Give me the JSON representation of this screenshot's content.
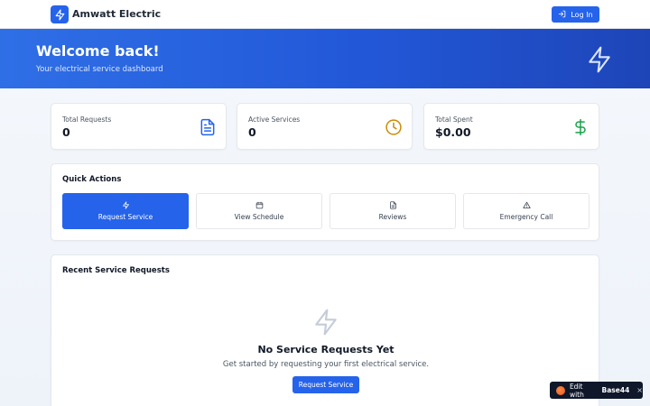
{
  "nav": {
    "brand": "Amwatt Electric",
    "login_label": "Log In"
  },
  "hero": {
    "title": "Welcome back!",
    "subtitle": "Your electrical service dashboard"
  },
  "stats": [
    {
      "label": "Total Requests",
      "value": "0",
      "icon": "document-icon",
      "color": "#2563eb"
    },
    {
      "label": "Active Services",
      "value": "0",
      "icon": "clock-icon",
      "color": "#ca8a04"
    },
    {
      "label": "Total Spent",
      "value": "$0.00",
      "icon": "dollar-icon",
      "color": "#16a34a"
    }
  ],
  "quick_actions": {
    "title": "Quick Actions",
    "items": [
      {
        "label": "Request Service",
        "icon": "bolt-icon"
      },
      {
        "label": "View Schedule",
        "icon": "calendar-icon"
      },
      {
        "label": "Reviews",
        "icon": "document-icon"
      },
      {
        "label": "Emergency Call",
        "icon": "warning-icon"
      }
    ]
  },
  "recent": {
    "title": "Recent Service Requests",
    "empty_title": "No Service Requests Yet",
    "empty_subtitle": "Get started by requesting your first electrical service.",
    "cta_label": "Request Service"
  },
  "badge": {
    "prefix": "Edit with",
    "brand": "Base44",
    "close": "×"
  },
  "colors": {
    "primary": "#2563eb",
    "hero_start": "#2f6fe6",
    "hero_end": "#1e45b8"
  }
}
